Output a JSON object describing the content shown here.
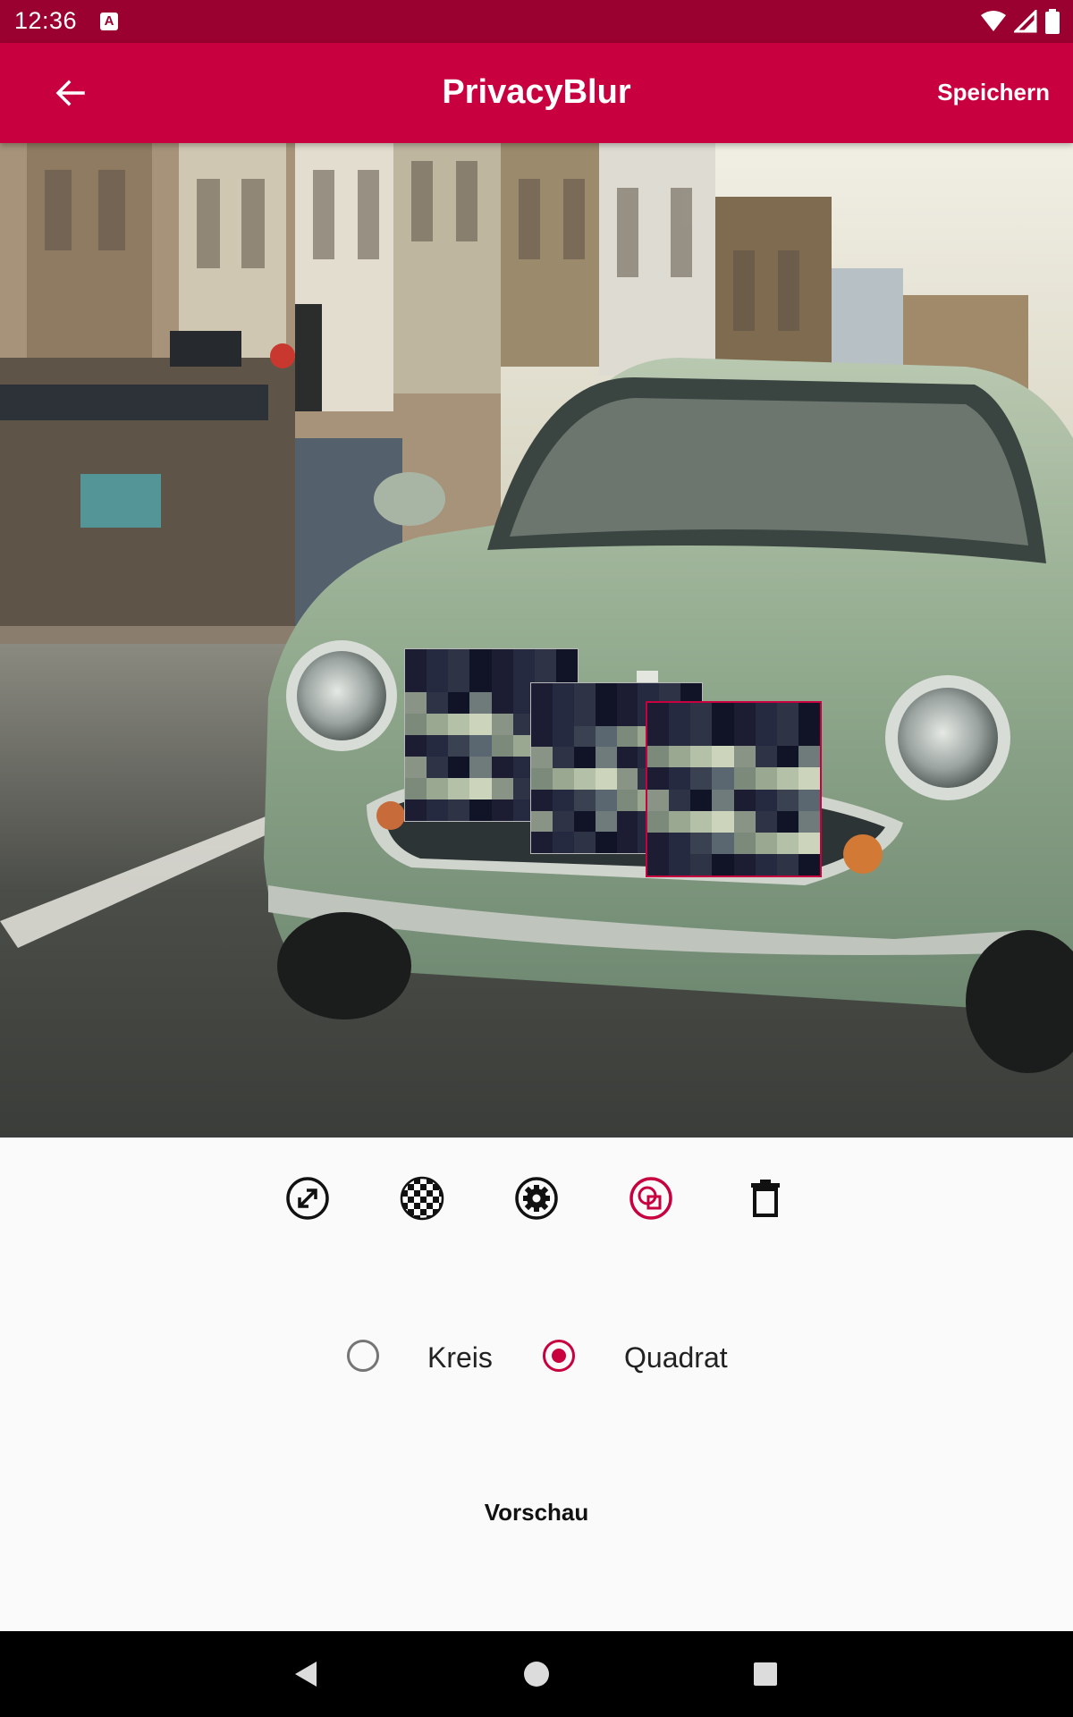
{
  "status_bar": {
    "time": "12:36",
    "notification_icon": "a-icon",
    "icons": [
      "wifi-icon",
      "signal-icon",
      "battery-icon"
    ]
  },
  "app_bar": {
    "title": "PrivacyBlur",
    "back_icon": "arrow-back-icon",
    "save_label": "Speichern"
  },
  "photo": {
    "description_icon": "photo-car"
  },
  "toolbar": {
    "tools": [
      {
        "name": "resize-icon"
      },
      {
        "name": "pixelate-icon"
      },
      {
        "name": "settings-icon"
      },
      {
        "name": "shape-icon",
        "active": true
      },
      {
        "name": "delete-icon"
      }
    ]
  },
  "shape": {
    "options": [
      {
        "label": "Kreis",
        "selected": false
      },
      {
        "label": "Quadrat",
        "selected": true
      }
    ]
  },
  "preview_label": "Vorschau",
  "nav_bar": {
    "buttons": [
      "back-nav-icon",
      "home-nav-icon",
      "recents-nav-icon"
    ]
  },
  "colors": {
    "accent": "#c8003f",
    "status_bar": "#9a0030",
    "background": "#fafafa"
  }
}
